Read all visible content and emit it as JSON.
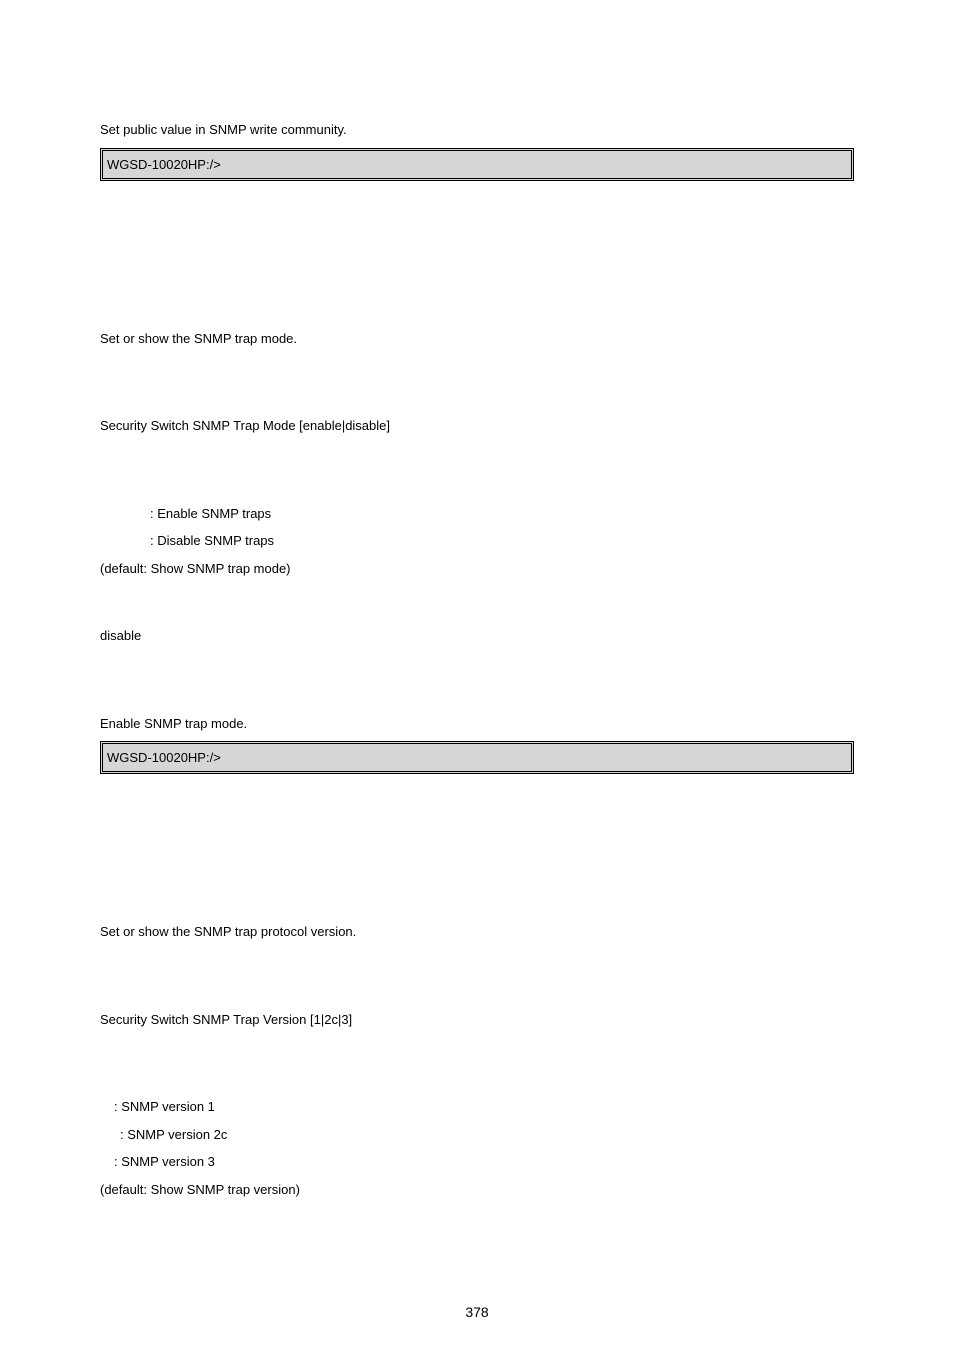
{
  "section1": {
    "intro": "Set public value in SNMP write community.",
    "code": "WGSD-10020HP:/>"
  },
  "section2": {
    "desc": "Set or show the SNMP trap mode.",
    "syntax": "Security Switch SNMP Trap Mode [enable|disable]",
    "param_enable": ": Enable SNMP traps",
    "param_disable": ": Disable SNMP traps",
    "param_default": "(default: Show SNMP trap mode)",
    "default_value": "disable",
    "example_text": "Enable SNMP trap mode.",
    "code": "WGSD-10020HP:/>"
  },
  "section3": {
    "desc": "Set or show the SNMP trap protocol version.",
    "syntax": "Security Switch SNMP Trap Version [1|2c|3]",
    "param_1": ": SNMP version 1",
    "param_2c": ": SNMP version 2c",
    "param_3": ": SNMP version 3",
    "param_default": "(default: Show SNMP trap version)"
  },
  "page_number": "378"
}
